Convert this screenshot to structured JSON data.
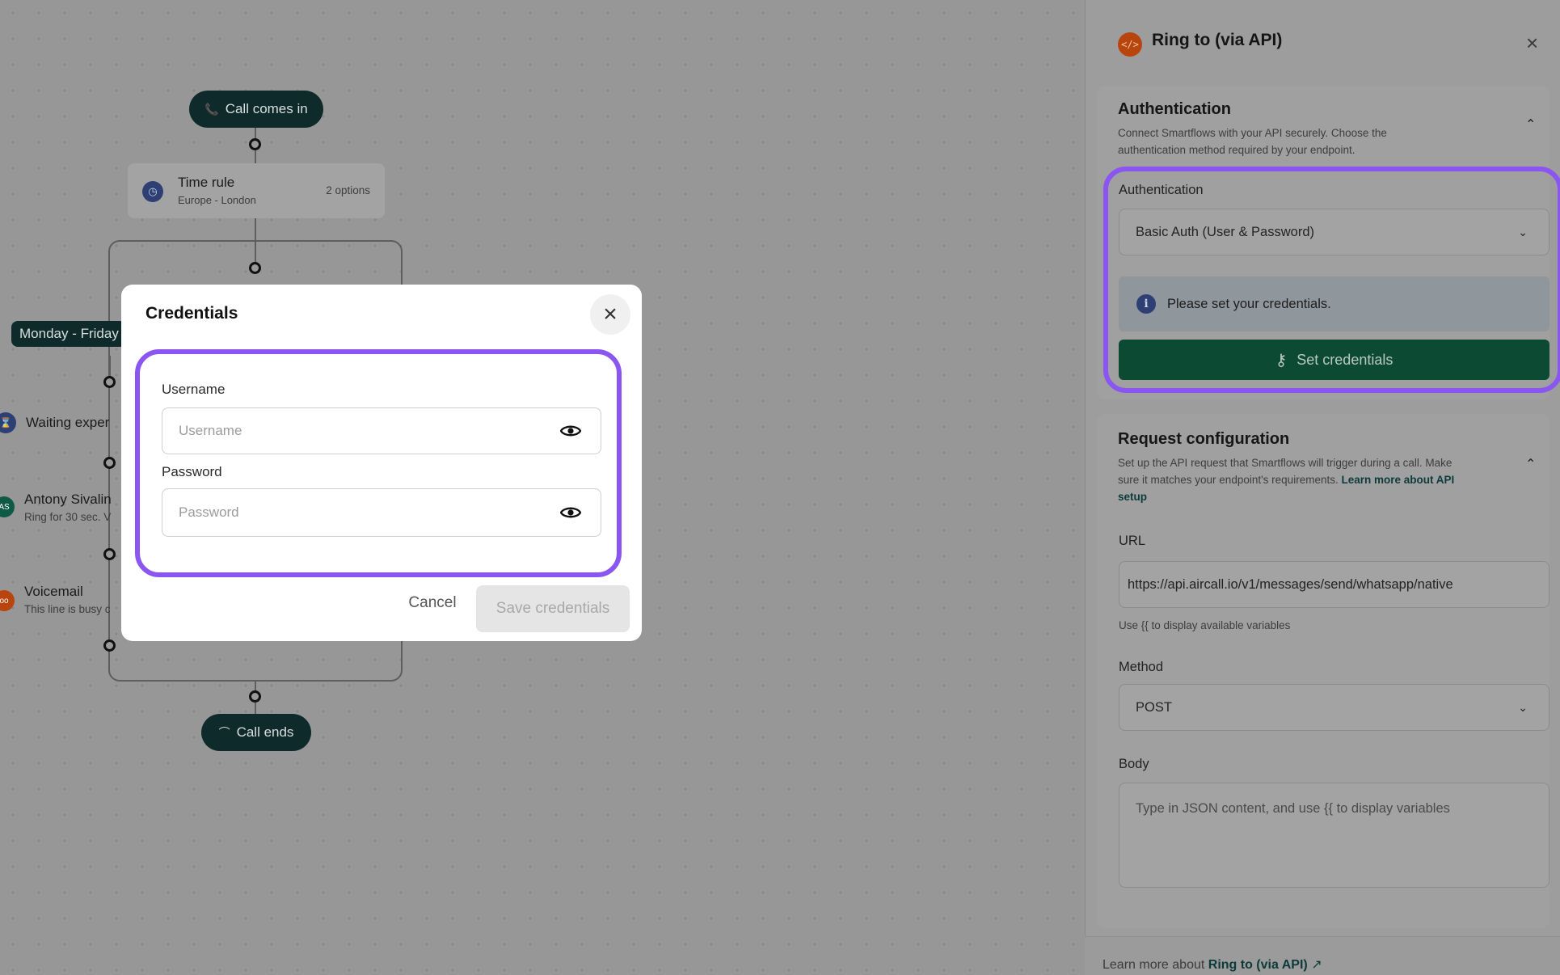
{
  "flow": {
    "start_label": "Call comes in",
    "time_rule": {
      "title": "Time rule",
      "subtitle": "Europe - London",
      "options": "2 options"
    },
    "branch_tag": "Monday - Friday",
    "nodes": [
      {
        "title": "Waiting exper",
        "subtitle": "",
        "badge": "⌛",
        "color": "#2d3f73"
      },
      {
        "title": "Antony Sivalin",
        "subtitle": "Ring for 30 sec. V",
        "badge": "AS",
        "color": "#0f5a44"
      },
      {
        "title": "Voicemail",
        "subtitle": "This line is busy c",
        "badge": "oo",
        "color": "#b8450d"
      }
    ],
    "end_label": "Call ends"
  },
  "modal": {
    "title": "Credentials",
    "username_label": "Username",
    "username_placeholder": "Username",
    "password_label": "Password",
    "password_placeholder": "Password",
    "cancel_label": "Cancel",
    "save_label": "Save credentials"
  },
  "panel": {
    "title": "Ring to (via API)",
    "auth_section": {
      "title": "Authentication",
      "desc_line1": "Connect Smartflows with your API securely. Choose the",
      "desc_line2": "authentication method required by your endpoint.",
      "field_label": "Authentication",
      "selected": "Basic Auth (User & Password)",
      "info_text": "Please set your credentials.",
      "set_credentials_label": "Set credentials"
    },
    "request_section": {
      "title": "Request configuration",
      "desc_line1": "Set up the API request that Smartflows will trigger during a call. Make",
      "desc_line2_prefix": "sure it matches your endpoint's requirements.",
      "desc_link_a": "Learn more about API",
      "desc_link_b": "setup",
      "url_label": "URL",
      "url_value": "https://api.aircall.io/v1/messages/send/whatsapp/native",
      "url_hint": "Use {{ to display available variables",
      "method_label": "Method",
      "method_value": "POST",
      "body_label": "Body",
      "body_placeholder": "Type in JSON content, and use {{ to display variables"
    },
    "footer": {
      "prefix": "Learn more about",
      "link": "Ring to (via API)"
    }
  },
  "colors": {
    "highlight": "#8a55f0",
    "primary_dark": "#0d4a33",
    "node_dark": "#0f2a2a"
  }
}
